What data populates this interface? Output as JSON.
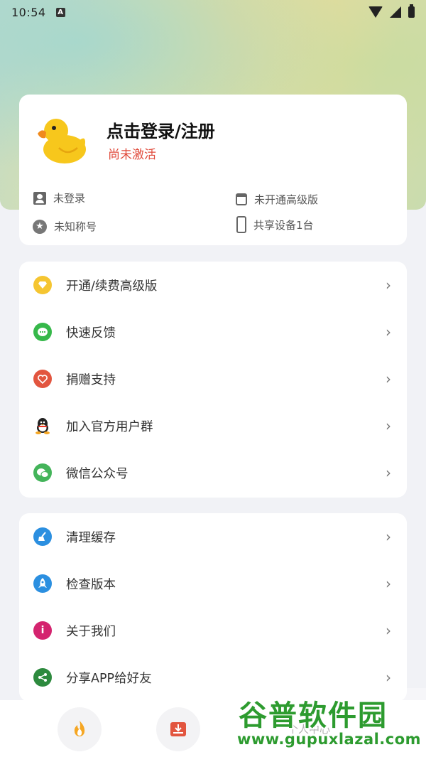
{
  "status_bar": {
    "time": "10:54",
    "notification_icon": "A"
  },
  "profile": {
    "login_title": "点击登录/注册",
    "status": "尚未激活",
    "login_state": "未登录",
    "nickname": "未知称号",
    "vip_state": "未开通高级版",
    "devices": "共享设备1台"
  },
  "menu_group_1": [
    {
      "label": "开通/续费高级版",
      "icon": "diamond-icon",
      "color": "#f5c531"
    },
    {
      "label": "快速反馈",
      "icon": "chat-icon",
      "color": "#36b84a"
    },
    {
      "label": "捐赠支持",
      "icon": "heart-icon",
      "color": "#e2553f"
    },
    {
      "label": "加入官方用户群",
      "icon": "qq-icon",
      "color": "#222222"
    },
    {
      "label": "微信公众号",
      "icon": "wechat-icon",
      "color": "#44b45a"
    }
  ],
  "menu_group_2": [
    {
      "label": "清理缓存",
      "icon": "broom-icon",
      "color": "#2b8fe0"
    },
    {
      "label": "检查版本",
      "icon": "rocket-icon",
      "color": "#2b8fe0"
    },
    {
      "label": "关于我们",
      "icon": "info-icon",
      "color": "#d4246f"
    },
    {
      "label": "分享APP给好友",
      "icon": "share-icon",
      "color": "#2d8a3e"
    }
  ],
  "tabbar": {
    "tab3_label": "个人中心"
  },
  "watermark": {
    "title": "谷普软件园",
    "url": "www.gupuxlazal.com"
  }
}
